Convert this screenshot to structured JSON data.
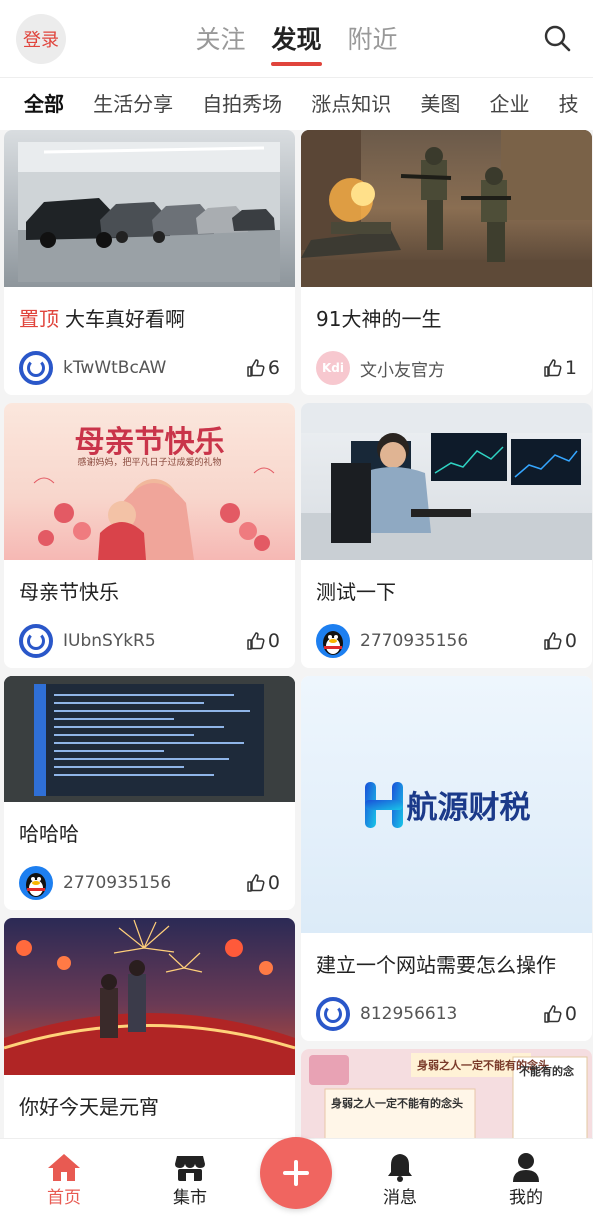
{
  "header": {
    "login_label": "登录",
    "tabs": [
      {
        "label": "关注",
        "active": false
      },
      {
        "label": "发现",
        "active": true
      },
      {
        "label": "附近",
        "active": false
      }
    ]
  },
  "categories": [
    "全部",
    "生活分享",
    "自拍秀场",
    "涨点知识",
    "美图",
    "企业",
    "技"
  ],
  "feed": {
    "left": [
      {
        "pin_label": "置顶",
        "title": "大车真好看啊",
        "author": "kTwWtBcAW",
        "likes": "6",
        "avatar": "blue-o-avatar",
        "image": "parking-garage-cars"
      },
      {
        "title": "母亲节快乐",
        "author": "IUbnSYkR5",
        "likes": "0",
        "avatar": "blue-o-avatar",
        "image": "mothers-day-card",
        "image_text": {
          "headline": "母亲节快乐",
          "sub": "感谢妈妈，把平凡日子过成爱的礼物"
        }
      },
      {
        "title": "哈哈哈",
        "author": "2770935156",
        "likes": "0",
        "avatar": "qq-penguin-avatar",
        "image": "code-monitor-photo"
      },
      {
        "title": "你好今天是元宵",
        "author": "",
        "likes": "",
        "avatar": "blue-o-avatar",
        "image": "lantern-festival-bridge"
      }
    ],
    "right": [
      {
        "title": "91大神的一生",
        "author": "文小友官方",
        "likes": "1",
        "avatar": "kdi-pink-avatar",
        "image": "soldiers-tank-battle",
        "avatar_text": "Kdi"
      },
      {
        "title": "测试一下",
        "author": "2770935156",
        "likes": "0",
        "avatar": "qq-penguin-avatar",
        "image": "trader-at-monitors"
      },
      {
        "title": "建立一个网站需要怎么操作",
        "author": "812956613",
        "likes": "0",
        "avatar": "blue-o-avatar",
        "image": "hangyuan-logo",
        "logo_text": "航源财税"
      },
      {
        "title": "",
        "author": "",
        "likes": "",
        "avatar": "",
        "image": "poster-collage",
        "poster_text": [
          "身弱之人一定不能有的念头",
          "不能有的念",
          "身弱之人一定不能有的念头"
        ]
      }
    ]
  },
  "bottom_nav": [
    {
      "label": "首页",
      "icon": "home-icon",
      "active": true
    },
    {
      "label": "集市",
      "icon": "store-icon",
      "active": false
    },
    {
      "label": "",
      "icon": "plus-icon",
      "active": false
    },
    {
      "label": "消息",
      "icon": "bell-icon",
      "active": false
    },
    {
      "label": "我的",
      "icon": "user-icon",
      "active": false
    }
  ],
  "colors": {
    "accent": "#e0443c",
    "plus_button": "#f06560",
    "avatar_blue": "#2a57c9"
  }
}
